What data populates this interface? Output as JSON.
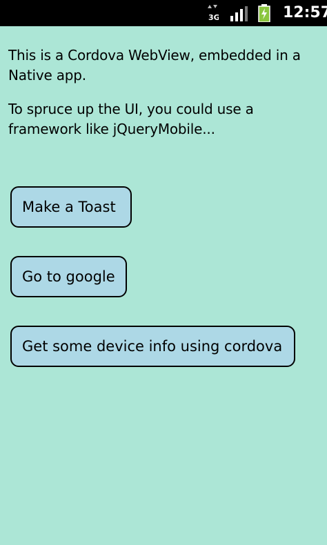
{
  "status_bar": {
    "network_label": "3G",
    "time": "12:57",
    "icons": [
      "data-arrows-icon",
      "signal-bars-icon",
      "battery-charging-icon"
    ]
  },
  "content": {
    "paragraph1": "This is a Cordova WebView, embedded in a Native app.",
    "paragraph2": "To spruce up the UI, you could use a framework like jQueryMobile..."
  },
  "buttons": {
    "toast": "Make a Toast",
    "google": "Go to google",
    "device_info": "Get some device info using cordova"
  },
  "colors": {
    "background": "#ace6d6",
    "button_fill": "#add8e6",
    "status_bar": "#000000"
  }
}
